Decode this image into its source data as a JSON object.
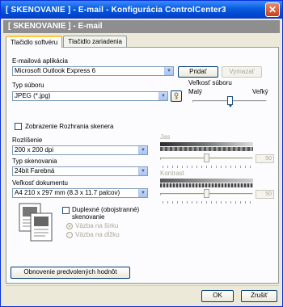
{
  "window": {
    "title": "[ SKENOVANIE ] - E-mail - Konfigurácia ControlCenter3",
    "close_glyph": "✕"
  },
  "header": {
    "title": "[ SKENOVANIE ] - E-mail"
  },
  "tabs": [
    {
      "label": "Tlačidlo softvéru",
      "active": true
    },
    {
      "label": "Tlačidlo zariadenia",
      "active": false
    }
  ],
  "email_app": {
    "label": "E-mailová aplikácia",
    "value": "Microsoft Outlook Express 6",
    "add_label": "Pridať",
    "delete_label": "Vymazať"
  },
  "file_type": {
    "label": "Typ súboru",
    "value": "JPEG (*.jpg)",
    "options_icon": "key-settings-icon"
  },
  "file_size": {
    "label": "Veľkosť súboru",
    "min_label": "Malý",
    "max_label": "Veľký",
    "level_fraction": 0.5
  },
  "show_interface": {
    "label": "Zobrazenie Rozhrania skenera",
    "checked": false
  },
  "resolution": {
    "label": "Rozlíšenie",
    "value": "200 x 200 dpi"
  },
  "scan_type": {
    "label": "Typ skenovania",
    "value": "24bit Farebná"
  },
  "doc_size": {
    "label": "Veľkosť dokumentu",
    "value": "A4 210 x 297 mm (8.3 x 11.7 palcov)"
  },
  "brightness": {
    "label": "Jas",
    "value": "50"
  },
  "contrast": {
    "label": "Kontrast",
    "value": "50"
  },
  "duplex": {
    "label_line1": "Duplexné (obojstranné)",
    "label_line2": "skenovanie",
    "checked": false,
    "long_edge": "Väzba na šírku",
    "short_edge": "Väzba na dĺžku"
  },
  "restore_defaults_label": "Obnovenie predvolených hodnôt",
  "footer": {
    "ok_label": "OK",
    "cancel_label": "Zrušiť"
  },
  "colors": {
    "title_blue": "#0a5bdc",
    "header_gray": "#8e8e8e",
    "panel_bg": "#fcfcfe"
  }
}
